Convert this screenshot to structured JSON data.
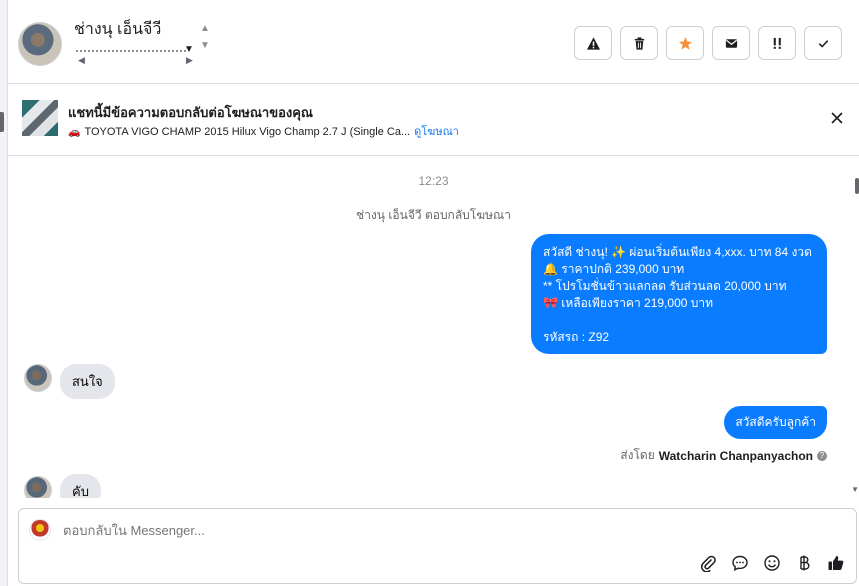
{
  "header": {
    "contact_name": "ช่างนุ เอ็นจีวี",
    "actions": [
      {
        "name": "report-spam-button",
        "icon": "warning-icon"
      },
      {
        "name": "delete-button",
        "icon": "trash-icon"
      },
      {
        "name": "star-button",
        "icon": "star-icon",
        "color": "#f7923b"
      },
      {
        "name": "mark-unread-button",
        "icon": "envelope-icon"
      },
      {
        "name": "follow-up-button",
        "icon": "priority-icon"
      },
      {
        "name": "mark-done-button",
        "icon": "check-icon"
      }
    ]
  },
  "banner": {
    "title": "แชทนี้มีข้อความตอบกลับต่อโฆษณาของคุณ",
    "ad_text": "TOYOTA VIGO CHAMP 2015 Hilux Vigo Champ 2.7 J (Single Ca...",
    "link": "ดูโฆษณา"
  },
  "messages": {
    "timestamp": "12:23",
    "system_note": "ช่างนุ เอ็นจีวี ตอบกลับโฆษณา",
    "outgoing_1_lines": [
      "สวัสดี ช่างนุ! ✨  ผ่อนเริ่มต้นเพียง 4,xxx. บาท 84 งวด",
      "🔔 ราคาปกติ 239,000 บาท",
      "** โปรโมชั่นข้าวแลกลด รับส่วนลด 20,000 บาท",
      "🎀  เหลือเพียงราคา 219,000 บาท",
      "",
      "รหัสรถ : Z92"
    ],
    "incoming_1": "สนใจ",
    "outgoing_2": "สวัสดีครับลูกค้า",
    "sent_by_prefix": "ส่งโดย",
    "sent_by_name": "Watcharin Chanpanyachon",
    "incoming_2": "คับ"
  },
  "composer": {
    "placeholder": "ตอบกลับใน Messenger..."
  },
  "colors": {
    "accent": "#0a7cff",
    "link": "#1877f2",
    "incoming_bubble": "#e4e6eb"
  }
}
